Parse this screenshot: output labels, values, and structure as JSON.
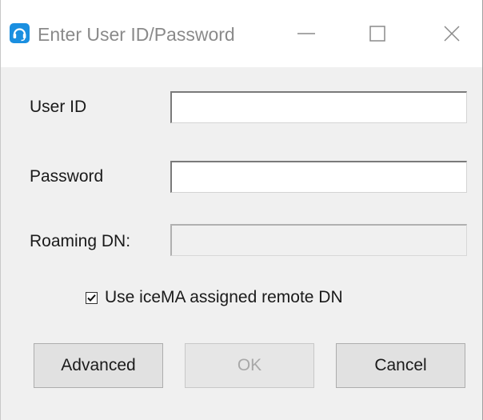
{
  "window": {
    "title": "Enter User ID/Password",
    "icon": "headset-icon",
    "controls": {
      "minimize": "minimize-icon",
      "maximize": "maximize-icon",
      "close": "close-icon"
    }
  },
  "form": {
    "user_id": {
      "label": "User ID",
      "value": ""
    },
    "password": {
      "label": "Password",
      "value": ""
    },
    "roaming_dn": {
      "label": "Roaming DN:",
      "value": "",
      "enabled": false
    },
    "use_assigned_remote_dn": {
      "label": "Use iceMA assigned remote DN",
      "checked": true
    }
  },
  "buttons": {
    "advanced": "Advanced",
    "ok": "OK",
    "cancel": "Cancel"
  },
  "colors": {
    "icon_accent": "#1a8fe0",
    "title_text": "#8a8a8a",
    "dialog_background": "#f0f0f0",
    "disabled_text": "#a8a8a8"
  }
}
